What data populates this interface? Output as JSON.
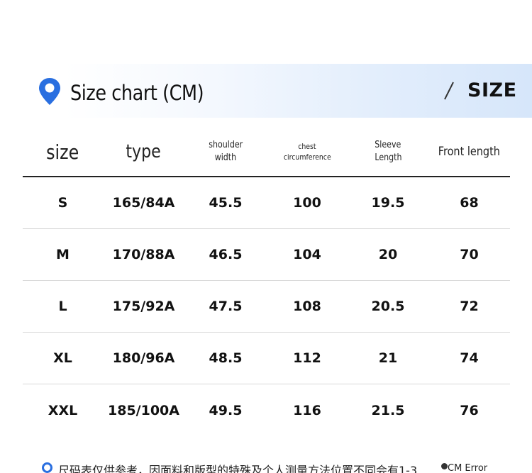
{
  "header": {
    "title": "Size chart (CM)",
    "size_label": "SIZE",
    "accent_color": "#2a6fe0"
  },
  "table": {
    "columns": [
      {
        "label": "size"
      },
      {
        "label": "type"
      },
      {
        "line1": "shoulder",
        "line2": "width"
      },
      {
        "line1": "chest",
        "line2": "circumference"
      },
      {
        "line1": "Sleeve",
        "line2": "Length"
      },
      {
        "label": "Front length"
      }
    ],
    "rows": [
      [
        "S",
        "165/84A",
        "45.5",
        "100",
        "19.5",
        "68"
      ],
      [
        "M",
        "170/88A",
        "46.5",
        "104",
        "20",
        "70"
      ],
      [
        "L",
        "175/92A",
        "47.5",
        "108",
        "20.5",
        "72"
      ],
      [
        "XL",
        "180/96A",
        "48.5",
        "112",
        "21",
        "74"
      ],
      [
        "XXL",
        "185/100A",
        "49.5",
        "116",
        "21.5",
        "76"
      ]
    ]
  },
  "footer": {
    "note": "尺码表仅供参考，因面料和版型的特殊及个人测量方法位置不同会有1-3",
    "tail": "CM Error"
  },
  "icons": {
    "location": "location-pin-icon",
    "divider": "slash-icon",
    "bullet": "circle-bullet-icon"
  }
}
